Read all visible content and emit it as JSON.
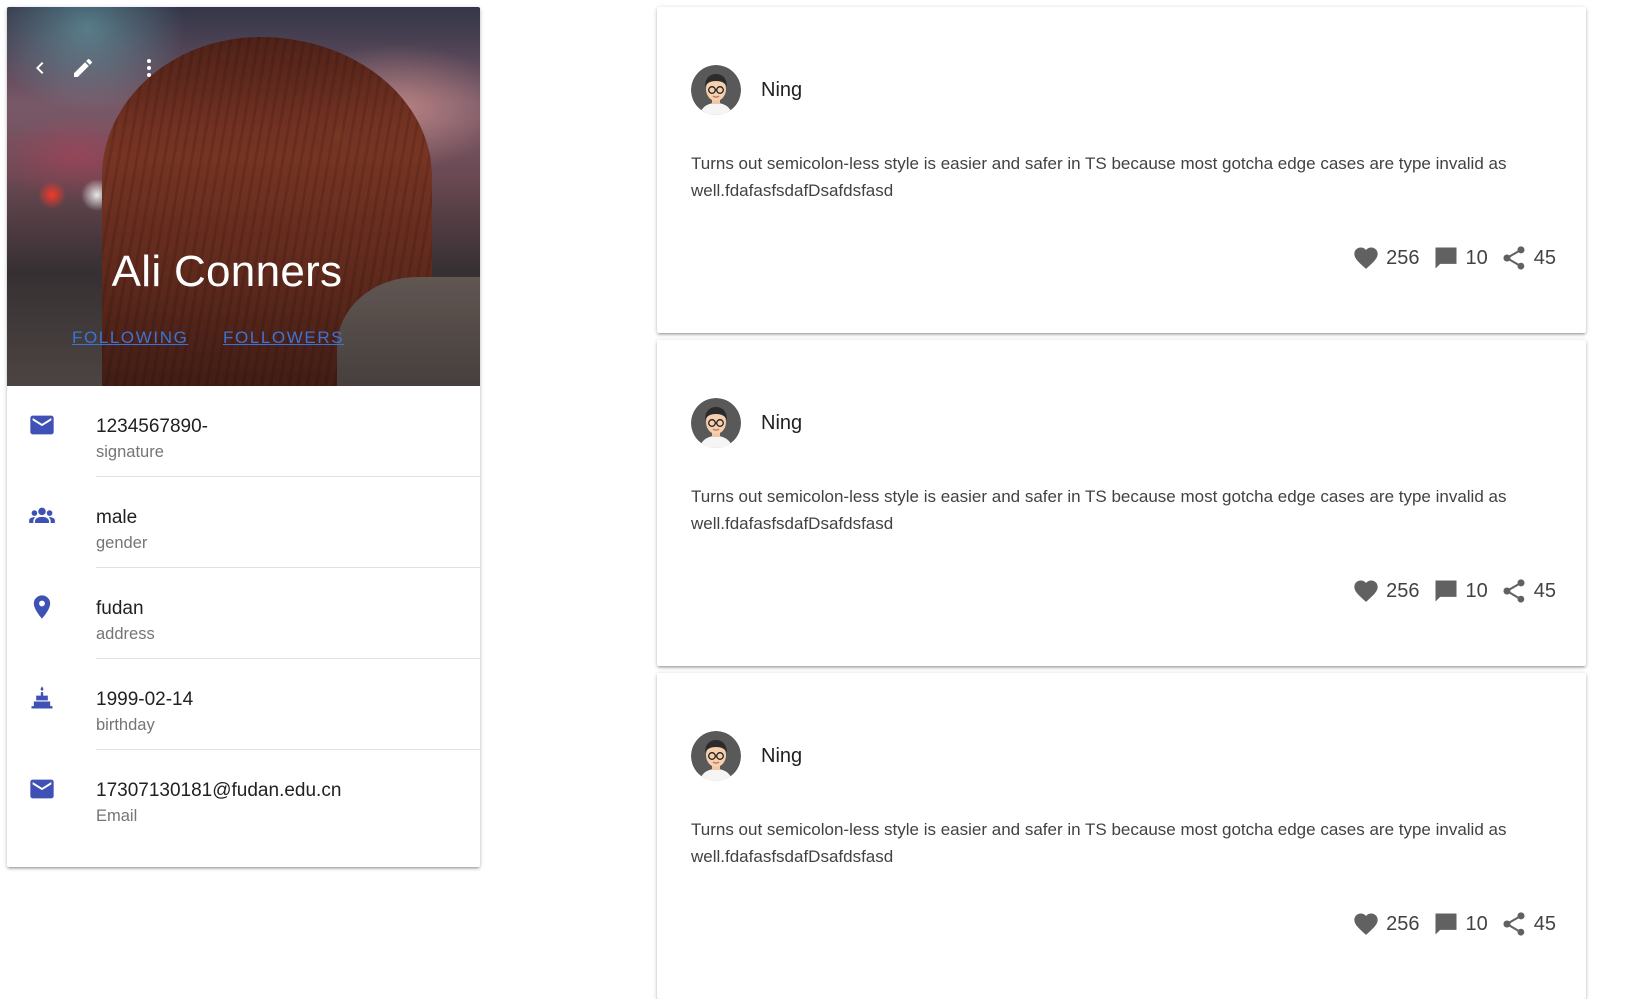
{
  "profile": {
    "name": "Ali Conners",
    "links": {
      "following": "FOLLOWING",
      "followers": "FOLLOWERS"
    },
    "toolbar": [
      "back-icon",
      "pencil-icon",
      "more-vert-icon"
    ],
    "info": [
      {
        "icon": "mail-icon",
        "value": "1234567890-",
        "label": "signature"
      },
      {
        "icon": "people-icon",
        "value": "male",
        "label": "gender"
      },
      {
        "icon": "map-marker-icon",
        "value": "fudan",
        "label": "address"
      },
      {
        "icon": "cake-icon",
        "value": "1999-02-14",
        "label": "birthday"
      },
      {
        "icon": "mail-icon",
        "value": "17307130181@fudan.edu.cn",
        "label": "Email"
      }
    ]
  },
  "posts": [
    {
      "author": "Ning",
      "text": "Turns out semicolon-less style is easier and safer in TS because most gotcha edge cases are type invalid as well.fdafasfsdafDsafdsfasd",
      "likes": "256",
      "comments": "10",
      "shares": "45"
    },
    {
      "author": "Ning",
      "text": "Turns out semicolon-less style is easier and safer in TS because most gotcha edge cases are type invalid as well.fdafasfsdafDsafdsfasd",
      "likes": "256",
      "comments": "10",
      "shares": "45"
    },
    {
      "author": "Ning",
      "text": "Turns out semicolon-less style is easier and safer in TS because most gotcha edge cases are type invalid as well.fdafasfsdafDsafdsfasd",
      "likes": "256",
      "comments": "10",
      "shares": "45"
    }
  ],
  "colors": {
    "accent": "#3f51b5",
    "link": "#3b74d6",
    "icon_gray": "#616161"
  }
}
